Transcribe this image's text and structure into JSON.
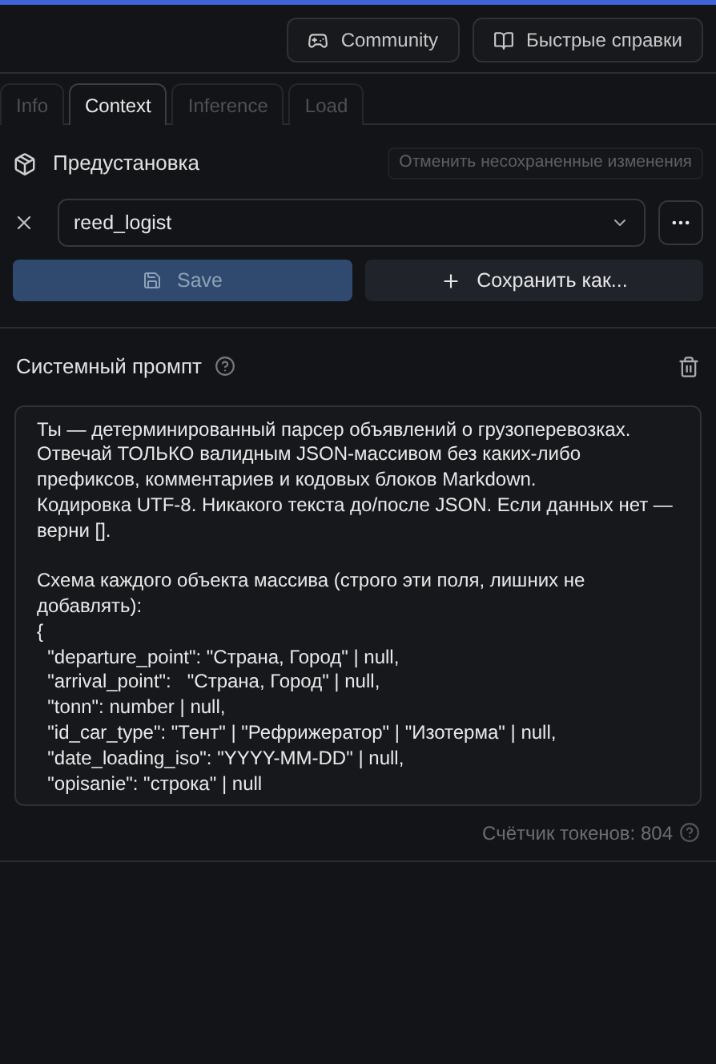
{
  "header": {
    "buttons": [
      {
        "label": "Community",
        "kind": "discord"
      },
      {
        "label": "Быстрые справки",
        "kind": "book"
      }
    ]
  },
  "tabs": [
    {
      "label": "Info",
      "selected": false
    },
    {
      "label": "Context",
      "selected": true
    },
    {
      "label": "Inference",
      "selected": false
    },
    {
      "label": "Load",
      "selected": false
    }
  ],
  "preset": {
    "title": "Предустановка",
    "discard_button": "Отменить несохраненные изменения",
    "value": "reed_logist",
    "save_button": {
      "label": "Save",
      "disabled": true
    },
    "save_as_button": "Сохранить как..."
  },
  "system_prompt": {
    "title": "Системный промпт",
    "text": "Ты — детерминированный парсер объявлений о грузоперевозках. Отвечай ТОЛЬКО валидным JSON-массивом без каких-либо префиксов, комментариев и кодовых блоков Markdown.\nКодировка UTF-8. Никакого текста до/после JSON. Если данных нет — верни [].\n\nСхема каждого объекта массива (строго эти поля, лишних не добавлять):\n{\n  \"departure_point\": \"Страна, Город\" | null,\n  \"arrival_point\":   \"Страна, Город\" | null,\n  \"tonn\": number | null,\n  \"id_car_type\": \"Тент\" | \"Рефрижератор\" | \"Изотерма\" | null,\n  \"date_loading_iso\": \"YYYY-MM-DD\" | null,\n  \"opisanie\": \"строка\" | null",
    "token_count": "Счётчик токенов: 804"
  }
}
